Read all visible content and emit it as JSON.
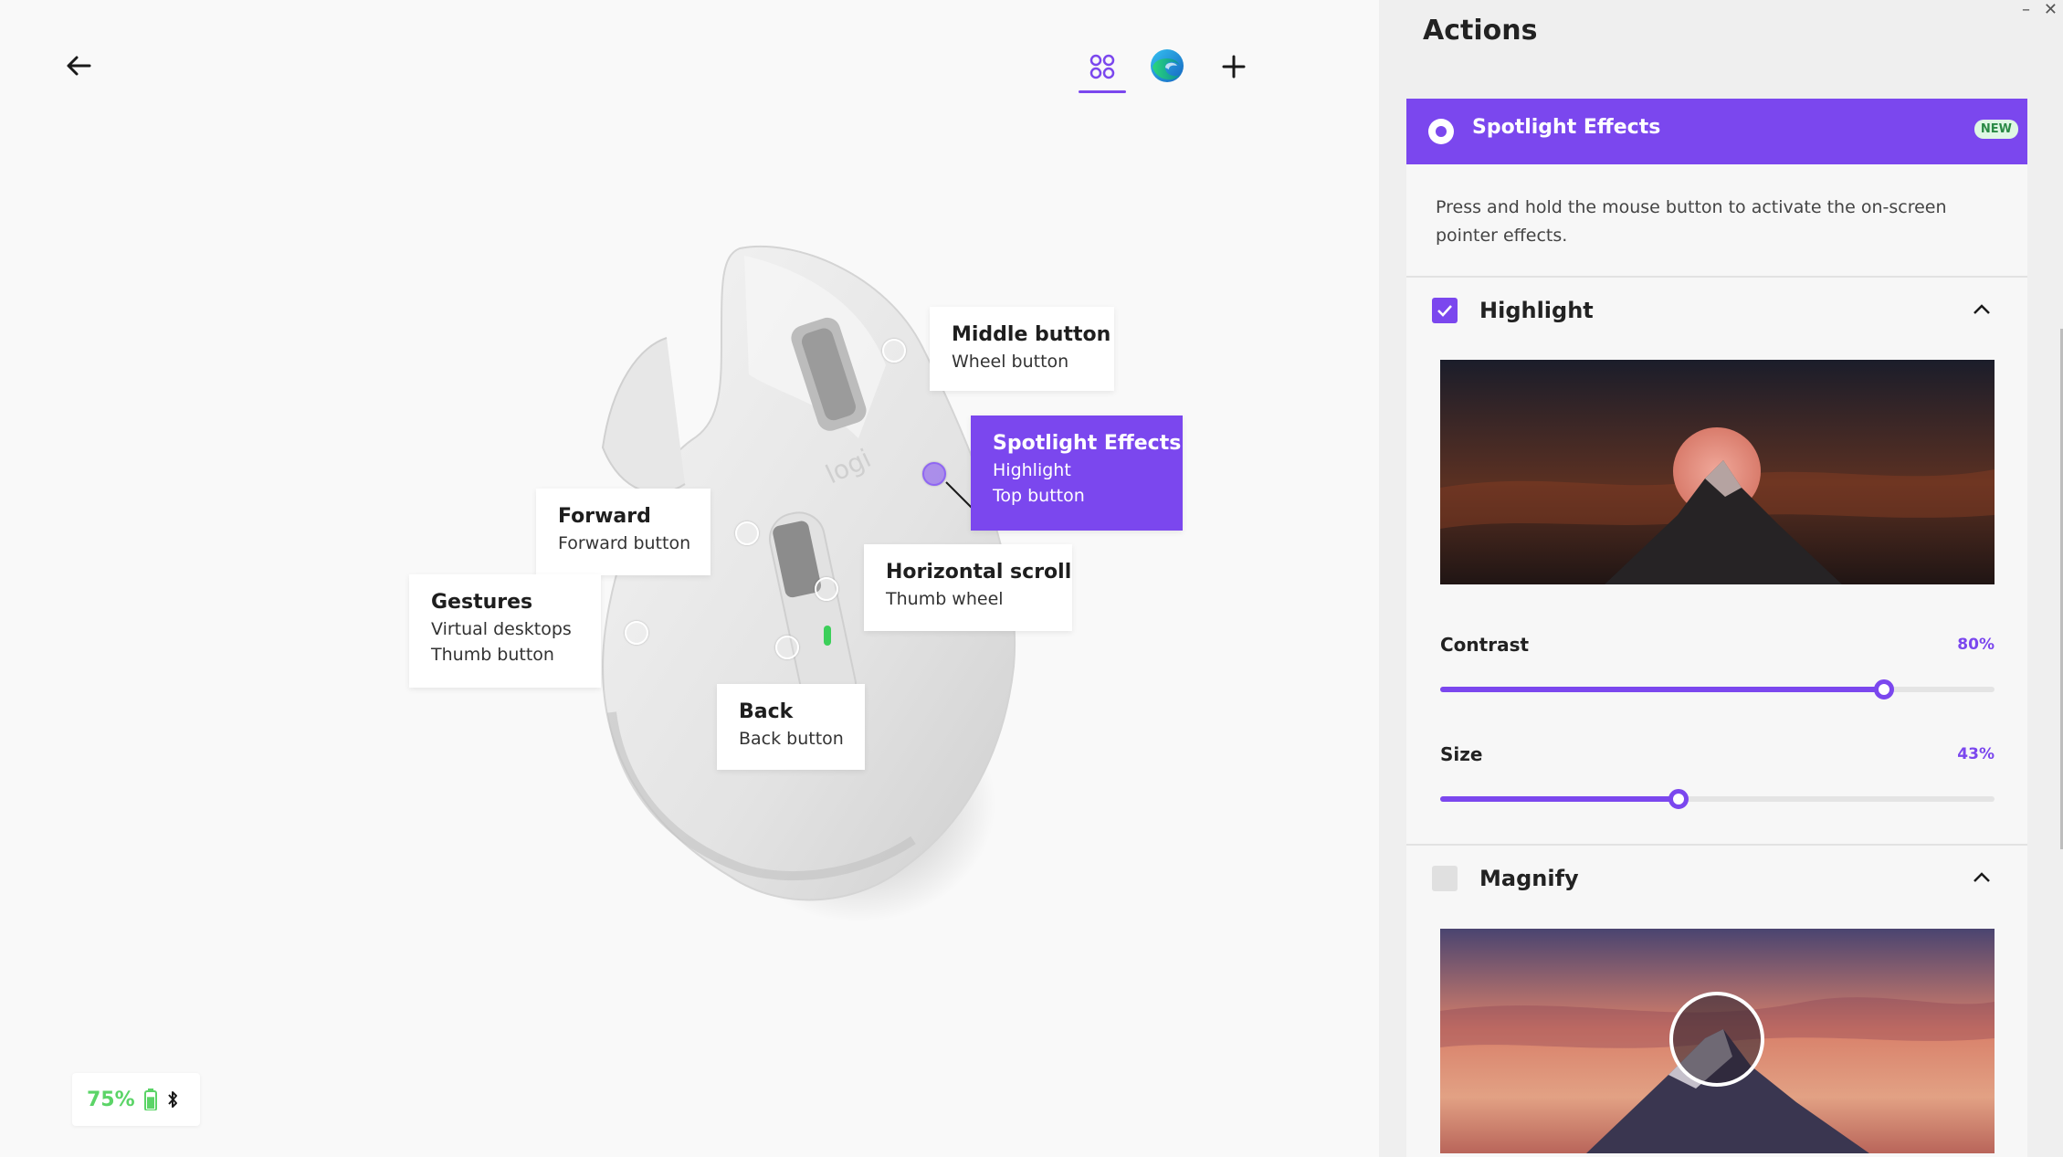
{
  "colors": {
    "accent": "#7b47ee",
    "battery_green": "#5bd467",
    "panel_bg": "#efefef"
  },
  "header": {
    "back_icon": "arrow-left-icon",
    "apps_icon": "apps-grid-icon",
    "edge_icon": "edge-browser-icon",
    "add_icon": "plus-icon"
  },
  "callouts": [
    {
      "key": "middle",
      "title": "Middle button",
      "sub": [
        "Wheel button"
      ]
    },
    {
      "key": "spotlight",
      "title": "Spotlight Effects",
      "sub": [
        "Highlight",
        "Top button"
      ]
    },
    {
      "key": "forward",
      "title": "Forward",
      "sub": [
        "Forward button"
      ]
    },
    {
      "key": "hscroll",
      "title": "Horizontal scroll",
      "sub": [
        "Thumb wheel"
      ]
    },
    {
      "key": "gestures",
      "title": "Gestures",
      "sub": [
        "Virtual desktops",
        "Thumb button"
      ]
    },
    {
      "key": "back",
      "title": "Back",
      "sub": [
        "Back button"
      ]
    }
  ],
  "battery": {
    "percent": "75%",
    "level": 0.75,
    "icons": [
      "battery-icon",
      "bluetooth-icon"
    ]
  },
  "panel": {
    "title": "Actions",
    "window_controls": [
      "–",
      "✕"
    ],
    "action": {
      "title": "Spotlight Effects",
      "badge": "NEW",
      "description": "Press and hold the mouse button to activate the on-screen pointer effects."
    },
    "highlight": {
      "label": "Highlight",
      "checked": true,
      "contrast": {
        "label": "Contrast",
        "value_text": "80%",
        "value": 0.8
      },
      "size": {
        "label": "Size",
        "value_text": "43%",
        "value": 0.43
      }
    },
    "magnify": {
      "label": "Magnify",
      "checked": false
    }
  }
}
